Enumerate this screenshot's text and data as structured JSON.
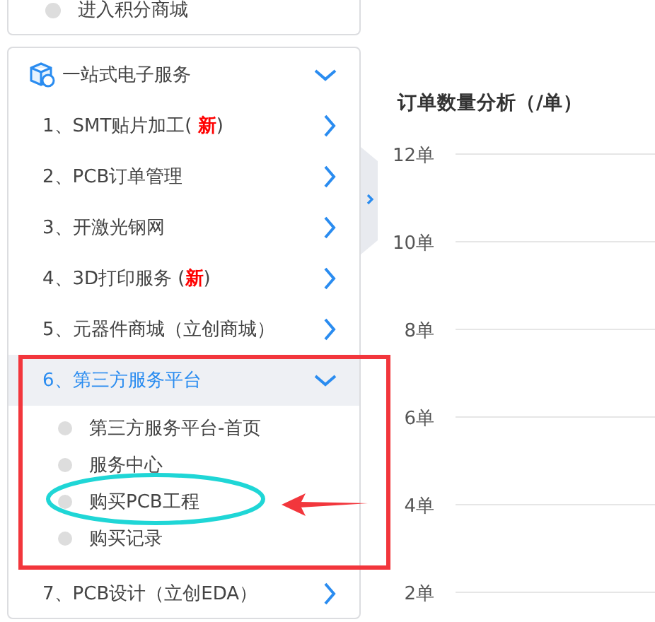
{
  "points_card": {
    "item": "进入积分商城"
  },
  "service_menu": {
    "title": "一站式电子服务",
    "expanded": true,
    "items": [
      {
        "label": "1、SMT贴片加工( **新**)",
        "selected": false,
        "expanded": false
      },
      {
        "label": "2、PCB订单管理",
        "selected": false,
        "expanded": false
      },
      {
        "label": "3、开激光钢网",
        "selected": false,
        "expanded": false
      },
      {
        "label": "4、3D打印服务 (**新**)",
        "selected": false,
        "expanded": false
      },
      {
        "label": "5、元器件商城（立创商城）",
        "selected": false,
        "expanded": false
      },
      {
        "label": "6、第三方服务平台",
        "selected": true,
        "expanded": true,
        "children": [
          {
            "label": "第三方服务平台-首页"
          },
          {
            "label": "服务中心"
          },
          {
            "label": "购买PCB工程"
          },
          {
            "label": "购买记录"
          }
        ]
      },
      {
        "label": "7、PCB设计（立创EDA）",
        "selected": false,
        "expanded": false
      }
    ]
  },
  "chart": {
    "title": "订单数量分析（/单）",
    "axis_labels": [
      "12单",
      "10单",
      "8单",
      "6单",
      "4单",
      "2单"
    ]
  },
  "annotations": [
    {
      "kind": "box"
    },
    {
      "kind": "ellipse"
    },
    {
      "kind": "arrow"
    }
  ]
}
